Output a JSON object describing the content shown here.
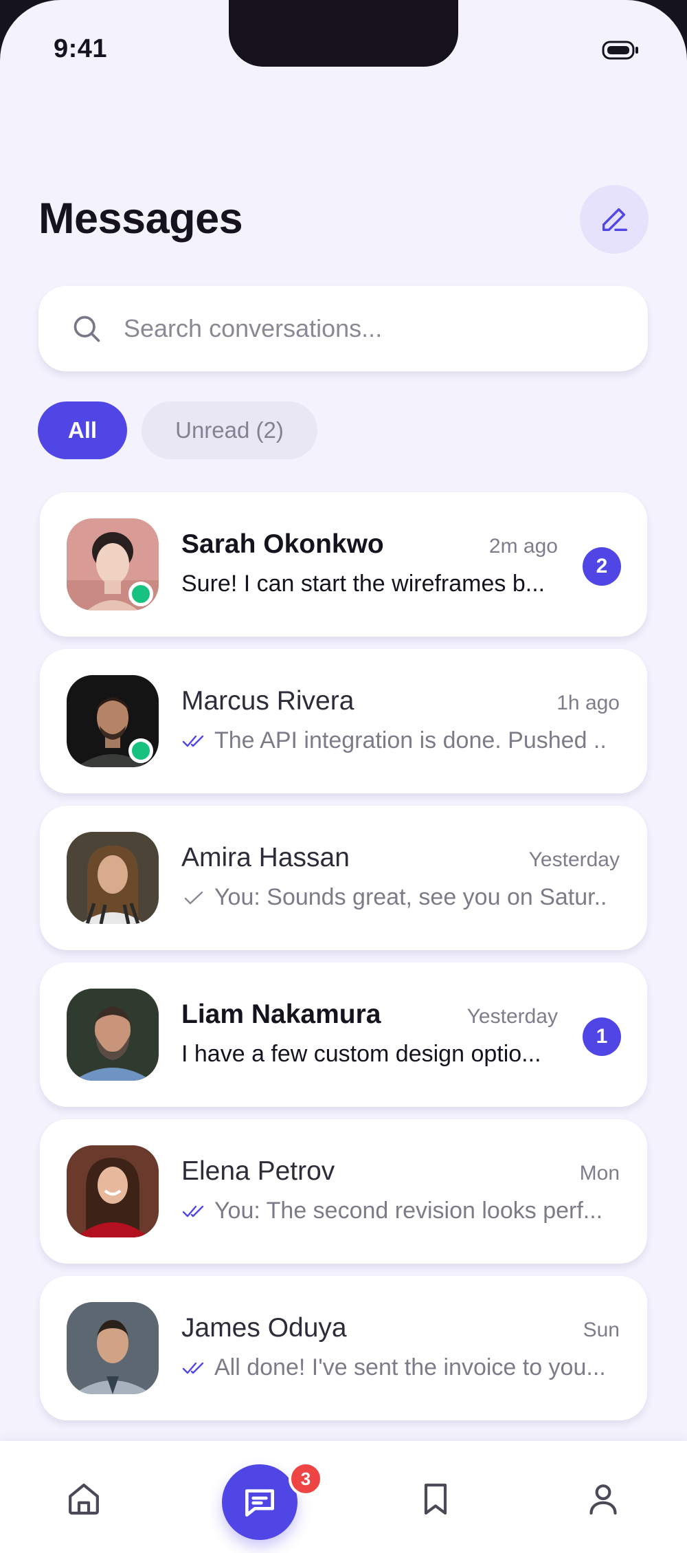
{
  "status_bar": {
    "time": "9:41"
  },
  "header": {
    "title": "Messages",
    "compose_icon": "pencil-icon"
  },
  "search": {
    "placeholder": "Search conversations..."
  },
  "filters": [
    {
      "label": "All",
      "selected": true
    },
    {
      "label": "Unread (2)",
      "selected": false
    }
  ],
  "conversations": [
    {
      "name": "Sarah Okonkwo",
      "time": "2m ago",
      "preview": "Sure! I can start the wireframes b...",
      "unread_count": "2",
      "online": true,
      "receipt": ""
    },
    {
      "name": "Marcus Rivera",
      "time": "1h ago",
      "preview": "The API integration is done. Pushed ...",
      "unread_count": "",
      "online": true,
      "receipt": "double-check-icon"
    },
    {
      "name": "Amira Hassan",
      "time": "Yesterday",
      "preview": "You: Sounds great, see you on Satur...",
      "unread_count": "",
      "online": false,
      "receipt": "check-icon"
    },
    {
      "name": "Liam Nakamura",
      "time": "Yesterday",
      "preview": "I have a few custom design optio...",
      "unread_count": "1",
      "online": false,
      "receipt": ""
    },
    {
      "name": "Elena Petrov",
      "time": "Mon",
      "preview": "You: The second revision looks perf...",
      "unread_count": "",
      "online": false,
      "receipt": "double-check-icon"
    },
    {
      "name": "James Oduya",
      "time": "Sun",
      "preview": "All done! I've sent the invoice to you...",
      "unread_count": "",
      "online": false,
      "receipt": "double-check-icon"
    }
  ],
  "bottom_nav": {
    "items": [
      "home-icon",
      "chat-bubble-icon",
      "bookmark-icon",
      "user-icon"
    ],
    "active": "chat-bubble-icon",
    "messages_badge": "3"
  },
  "colors": {
    "accent": "#4f46e5",
    "background": "#f4f2fd",
    "online": "#17c17f",
    "badge_red": "#ef4444"
  }
}
